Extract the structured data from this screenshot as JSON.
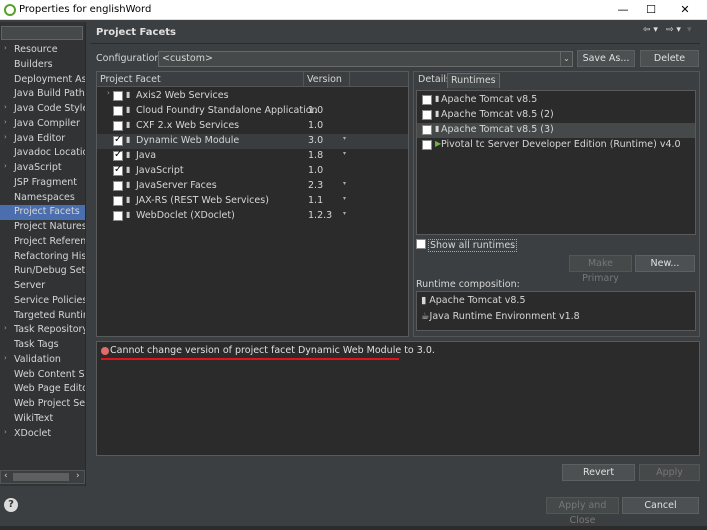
{
  "window": {
    "title": "Properties for englishWord",
    "minimize": "—",
    "maximize": "☐",
    "close": "✕"
  },
  "sidebar": {
    "items": [
      {
        "label": "Resource",
        "expandable": true
      },
      {
        "label": "Builders"
      },
      {
        "label": "Deployment Ass"
      },
      {
        "label": "Java Build Path"
      },
      {
        "label": "Java Code Style",
        "expandable": true
      },
      {
        "label": "Java Compiler",
        "expandable": true
      },
      {
        "label": "Java Editor",
        "expandable": true
      },
      {
        "label": "Javadoc Location"
      },
      {
        "label": "JavaScript",
        "expandable": true
      },
      {
        "label": "JSP Fragment"
      },
      {
        "label": "Namespaces"
      },
      {
        "label": "Project Facets",
        "selected": true
      },
      {
        "label": "Project Natures"
      },
      {
        "label": "Project Reference"
      },
      {
        "label": "Refactoring Histo"
      },
      {
        "label": "Run/Debug Setti"
      },
      {
        "label": "Server"
      },
      {
        "label": "Service Policies"
      },
      {
        "label": "Targeted Runtim"
      },
      {
        "label": "Task Repository",
        "expandable": true
      },
      {
        "label": "Task Tags"
      },
      {
        "label": "Validation",
        "expandable": true
      },
      {
        "label": "Web Content Set"
      },
      {
        "label": "Web Page Editor"
      },
      {
        "label": "Web Project Sett"
      },
      {
        "label": "WikiText"
      },
      {
        "label": "XDoclet",
        "expandable": true
      }
    ]
  },
  "header": {
    "title": "Project Facets"
  },
  "configuration": {
    "label": "Configuration:",
    "value": "<custom>",
    "save_as": "Save As...",
    "delete": "Delete"
  },
  "facets": {
    "col_facet": "Project Facet",
    "col_version": "Version",
    "rows": [
      {
        "name": "Axis2 Web Services",
        "version": "",
        "checked": false,
        "expandable": true
      },
      {
        "name": "Cloud Foundry Standalone Application",
        "version": "1.0",
        "checked": false
      },
      {
        "name": "CXF 2.x Web Services",
        "version": "1.0",
        "checked": false
      },
      {
        "name": "Dynamic Web Module",
        "version": "3.0",
        "checked": true,
        "highlight": true,
        "dropdown": true
      },
      {
        "name": "Java",
        "version": "1.8",
        "checked": true,
        "dropdown": true
      },
      {
        "name": "JavaScript",
        "version": "1.0",
        "checked": true
      },
      {
        "name": "JavaServer Faces",
        "version": "2.3",
        "checked": false,
        "dropdown": true
      },
      {
        "name": "JAX-RS (REST Web Services)",
        "version": "1.1",
        "checked": false,
        "dropdown": true
      },
      {
        "name": "WebDoclet (XDoclet)",
        "version": "1.2.3",
        "checked": false,
        "dropdown": true
      }
    ]
  },
  "runtimes_panel": {
    "tab_details": "Details",
    "tab_runtimes": "Runtimes",
    "runtimes": [
      {
        "label": "Apache Tomcat v8.5",
        "checked": false
      },
      {
        "label": "Apache Tomcat v8.5 (2)",
        "checked": false
      },
      {
        "label": "Apache Tomcat v8.5 (3)",
        "checked": false,
        "selected": true
      },
      {
        "label": "Pivotal tc Server Developer Edition (Runtime) v4.0",
        "checked": false
      }
    ],
    "show_all": "Show all runtimes",
    "make_primary": "Make Primary",
    "new": "New...",
    "composition_label": "Runtime composition:",
    "composition": [
      "Apache Tomcat v8.5",
      "Java Runtime Environment v1.8"
    ]
  },
  "message": {
    "text": "Cannot change version of project facet Dynamic Web Module to 3.0."
  },
  "buttons": {
    "revert": "Revert",
    "apply": "Apply",
    "apply_close": "Apply and Close",
    "cancel": "Cancel",
    "help": "?"
  },
  "colors": {
    "selection": "#4b6eaf",
    "error_underline": "#e0141b",
    "background": "#3c3f41"
  }
}
